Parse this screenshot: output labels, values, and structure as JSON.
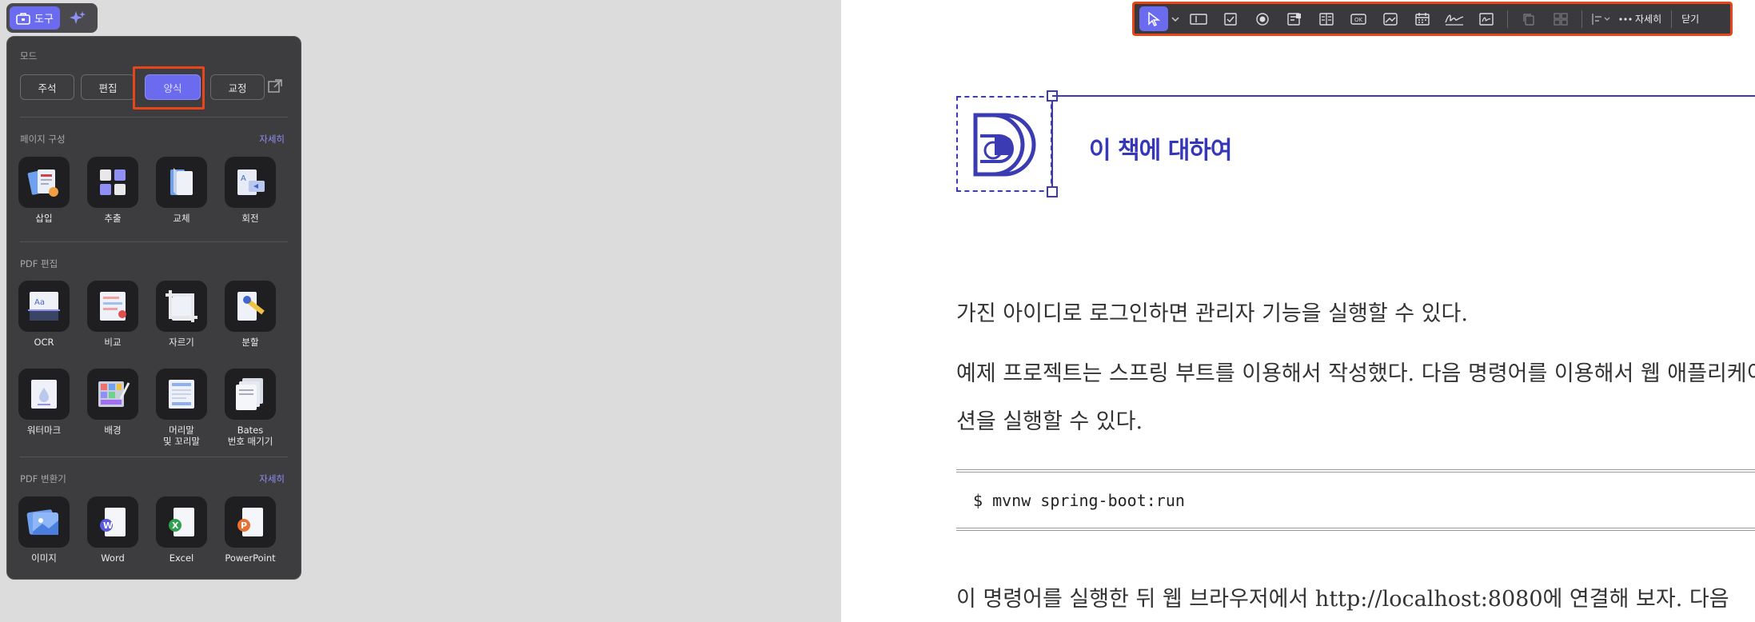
{
  "tool_pill": {
    "label": "도구"
  },
  "panel": {
    "mode_title": "모드",
    "modes": [
      "주석",
      "편집",
      "양식",
      "교정"
    ],
    "page_org": {
      "title": "페이지 구성",
      "more": "자세히",
      "items": [
        "삽입",
        "추출",
        "교체",
        "회전"
      ]
    },
    "pdf_edit": {
      "title": "PDF 편집",
      "items": [
        "OCR",
        "비교",
        "자르기",
        "분할"
      ],
      "items2": [
        "워터마크",
        "배경",
        "머리말\n및 꼬리말",
        "Bates\n번호 매기기"
      ]
    },
    "pdf_convert": {
      "title": "PDF 변환기",
      "more": "자세히",
      "items": [
        "이미지",
        "Word",
        "Excel",
        "PowerPoint"
      ]
    }
  },
  "form_toolbar": {
    "more": "자세히",
    "close": "닫기"
  },
  "doc": {
    "chapter_title": "이 책에 대하여",
    "p1": "가진 아이디로 로그인하면 관리자 기능을 실행할 수 있다.",
    "p2": "예제 프로젝트는 스프링 부트를 이용해서 작성했다. 다음 명령어를 이용해서 웹 애플리케이",
    "p3": "션을 실행할 수 있다.",
    "code": "$ mvnw spring-boot:run",
    "p4": "이 명령어를 실행한 뒤 웹 브라우저에서 http://localhost:8080에 연결해 보자. 다음"
  },
  "colors": {
    "accent": "#6b6bf0",
    "highlight": "#e8451a",
    "doc_blue": "#3636b8"
  }
}
